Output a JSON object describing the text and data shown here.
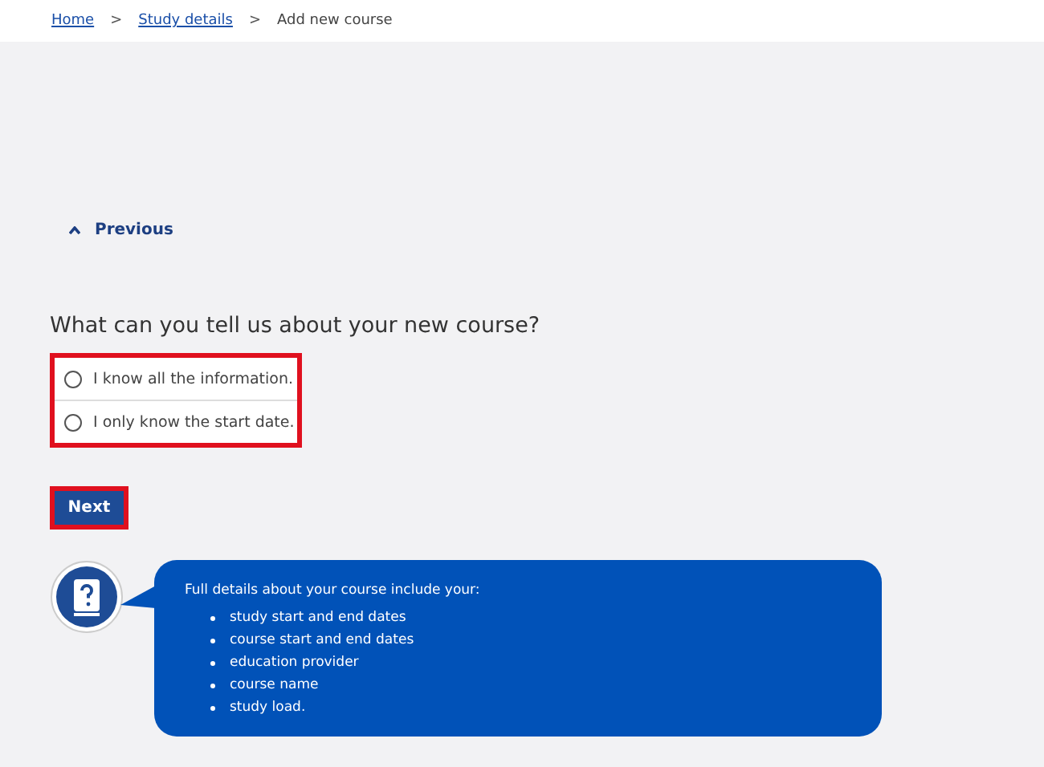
{
  "breadcrumb": {
    "links": [
      "Home",
      "Study details"
    ],
    "separators": [
      ">",
      ">"
    ],
    "current": "Add new course"
  },
  "previous": {
    "label": "Previous"
  },
  "question": "What can you tell us about your new course?",
  "options": [
    {
      "label": "I know all the information.",
      "selected": false
    },
    {
      "label": "I only know the start date.",
      "selected": false
    }
  ],
  "next_button": "Next",
  "help": {
    "intro": "Full details about your course include your:",
    "items": [
      "study start and end dates",
      "course start and end dates",
      "education provider",
      "course name",
      "study load."
    ]
  }
}
